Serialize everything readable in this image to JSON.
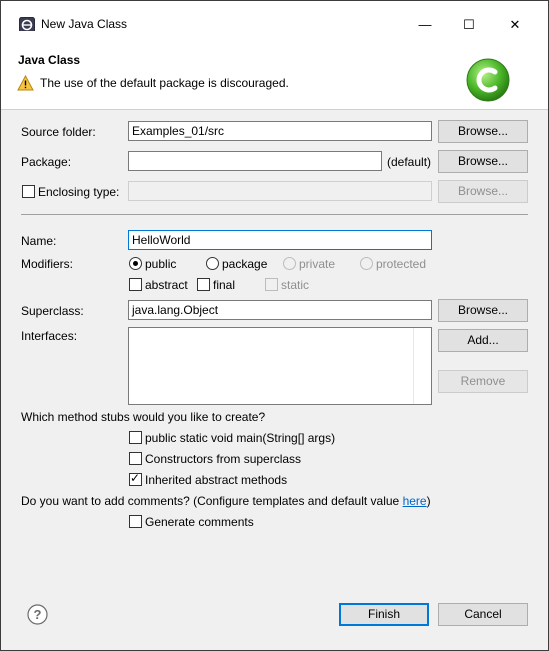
{
  "window": {
    "title": "New Java Class",
    "minimize_label": "—",
    "maximize_label": "☐",
    "close_label": "✕"
  },
  "header": {
    "title": "Java Class",
    "message": "The use of the default package is discouraged."
  },
  "source_folder": {
    "label": "Source folder:",
    "value": "Examples_01/src",
    "browse": "Browse..."
  },
  "package": {
    "label": "Package:",
    "value": "",
    "hint": "(default)",
    "browse": "Browse..."
  },
  "enclosing_type": {
    "label": "Enclosing type:",
    "value": "",
    "browse": "Browse...",
    "checked": false
  },
  "name": {
    "label": "Name:",
    "value": "HelloWorld"
  },
  "modifiers": {
    "label": "Modifiers:",
    "access": [
      "public",
      "package",
      "private",
      "protected"
    ],
    "selected": "public",
    "abstract": "abstract",
    "final": "final",
    "static": "static"
  },
  "superclass": {
    "label": "Superclass:",
    "value": "java.lang.Object",
    "browse": "Browse..."
  },
  "interfaces": {
    "label": "Interfaces:",
    "add": "Add...",
    "remove": "Remove"
  },
  "stubs": {
    "question": "Which method stubs would you like to create?",
    "main": "public static void main(String[] args)",
    "constructors": "Constructors from superclass",
    "inherited": "Inherited abstract methods",
    "inherited_checked": true
  },
  "comments": {
    "question_prefix": "Do you want to add comments? (Configure templates and default value ",
    "link": "here",
    "question_suffix": ")",
    "generate": "Generate comments"
  },
  "footer": {
    "help_label": "?",
    "finish": "Finish",
    "cancel": "Cancel"
  }
}
